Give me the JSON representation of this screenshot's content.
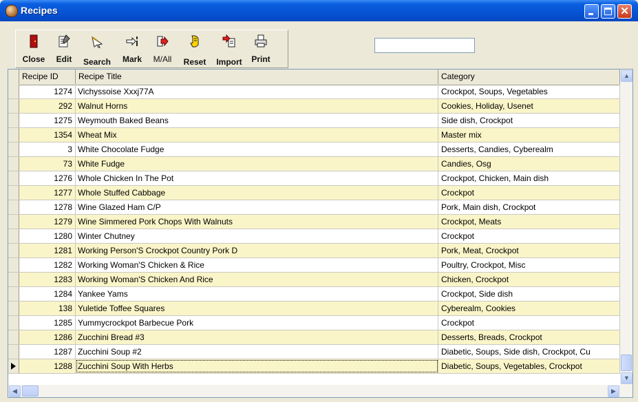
{
  "window": {
    "title": "Recipes",
    "icon": "chef-hat-icon"
  },
  "toolbar": {
    "items": [
      {
        "label": "Close",
        "icon": "close-door-icon"
      },
      {
        "label": "Edit",
        "icon": "edit-notepad-icon"
      },
      {
        "label": "Search",
        "icon": "search-arrow-icon"
      },
      {
        "label": "Mark",
        "icon": "mark-icon"
      },
      {
        "label": "M/All",
        "icon": "mark-all-icon"
      },
      {
        "label": "Reset",
        "icon": "reset-hand-icon"
      },
      {
        "label": "Import",
        "icon": "import-icon"
      },
      {
        "label": "Print",
        "icon": "printer-icon"
      }
    ]
  },
  "search": {
    "value": ""
  },
  "grid": {
    "columns": [
      "Recipe ID",
      "Recipe Title",
      "Category"
    ],
    "rows": [
      {
        "id": "1274",
        "title": "Vichyssoise Xxxj77A",
        "category": "Crockpot, Soups, Vegetables"
      },
      {
        "id": "292",
        "title": "Walnut Horns",
        "category": "Cookies, Holiday, Usenet"
      },
      {
        "id": "1275",
        "title": "Weymouth Baked Beans",
        "category": "Side dish, Crockpot"
      },
      {
        "id": "1354",
        "title": "Wheat Mix",
        "category": "Master mix"
      },
      {
        "id": "3",
        "title": "White Chocolate Fudge",
        "category": "Desserts, Candies, Cyberealm"
      },
      {
        "id": "73",
        "title": "White Fudge",
        "category": "Candies, Osg"
      },
      {
        "id": "1276",
        "title": "Whole Chicken In The Pot",
        "category": "Crockpot, Chicken, Main dish"
      },
      {
        "id": "1277",
        "title": "Whole Stuffed Cabbage",
        "category": "Crockpot"
      },
      {
        "id": "1278",
        "title": "Wine Glazed Ham C/P",
        "category": "Pork, Main dish, Crockpot"
      },
      {
        "id": "1279",
        "title": "Wine Simmered Pork Chops With Walnuts",
        "category": "Crockpot, Meats"
      },
      {
        "id": "1280",
        "title": "Winter Chutney",
        "category": "Crockpot"
      },
      {
        "id": "1281",
        "title": "Working Person'S Crockpot Country Pork D",
        "category": "Pork, Meat, Crockpot"
      },
      {
        "id": "1282",
        "title": "Working Woman'S Chicken & Rice",
        "category": "Poultry, Crockpot, Misc"
      },
      {
        "id": "1283",
        "title": "Working Woman'S Chicken And Rice",
        "category": "Chicken, Crockpot"
      },
      {
        "id": "1284",
        "title": "Yankee Yams",
        "category": "Crockpot, Side dish"
      },
      {
        "id": "138",
        "title": "Yuletide Toffee Squares",
        "category": "Cyberealm, Cookies"
      },
      {
        "id": "1285",
        "title": "Yummycrockpot  Barbecue Pork",
        "category": "Crockpot"
      },
      {
        "id": "1286",
        "title": "Zucchini Bread #3",
        "category": "Desserts, Breads, Crockpot"
      },
      {
        "id": "1287",
        "title": "Zucchini Soup #2",
        "category": "Diabetic, Soups, Side dish, Crockpot, Cu"
      },
      {
        "id": "1288",
        "title": "Zucchini Soup With Herbs",
        "category": "Diabetic, Soups, Vegetables, Crockpot"
      }
    ],
    "current_row": 19
  },
  "colors": {
    "title_bar": "#0653D3",
    "alt_row": "#FAF5C8",
    "window_bg": "#ECE9D8"
  }
}
